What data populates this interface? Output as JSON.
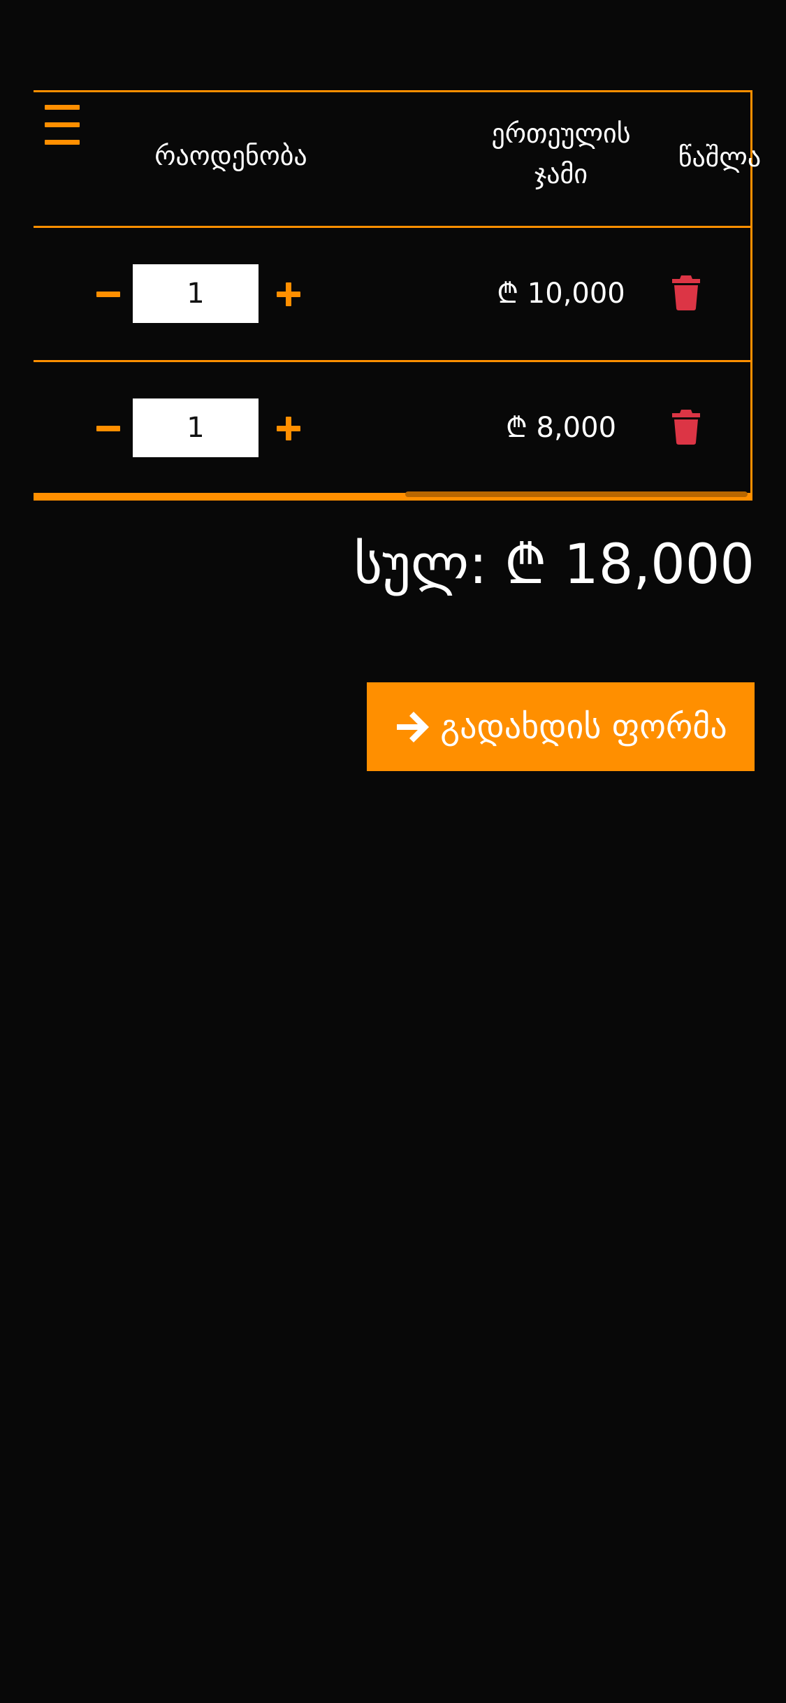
{
  "table": {
    "headers": {
      "quantity": "რაოდენობა",
      "unit_total": "ერთეულის\nჯამი",
      "delete": "წაშლა"
    },
    "rows": [
      {
        "quantity": "1",
        "price": "₾ 10,000"
      },
      {
        "quantity": "1",
        "price": "₾ 8,000"
      }
    ]
  },
  "summary": {
    "total_label": "სულ: ₾ 18,000"
  },
  "checkout": {
    "label": "გადახდის ფორმა"
  },
  "icons": {
    "menu": "menu-icon",
    "minus": "minus-icon",
    "plus": "plus-icon",
    "delete": "trash-icon",
    "arrow": "arrow-right-icon"
  },
  "colors": {
    "background": "#080808",
    "accent": "#ff8f00",
    "delete": "#dc3545",
    "text": "#ffffff"
  }
}
